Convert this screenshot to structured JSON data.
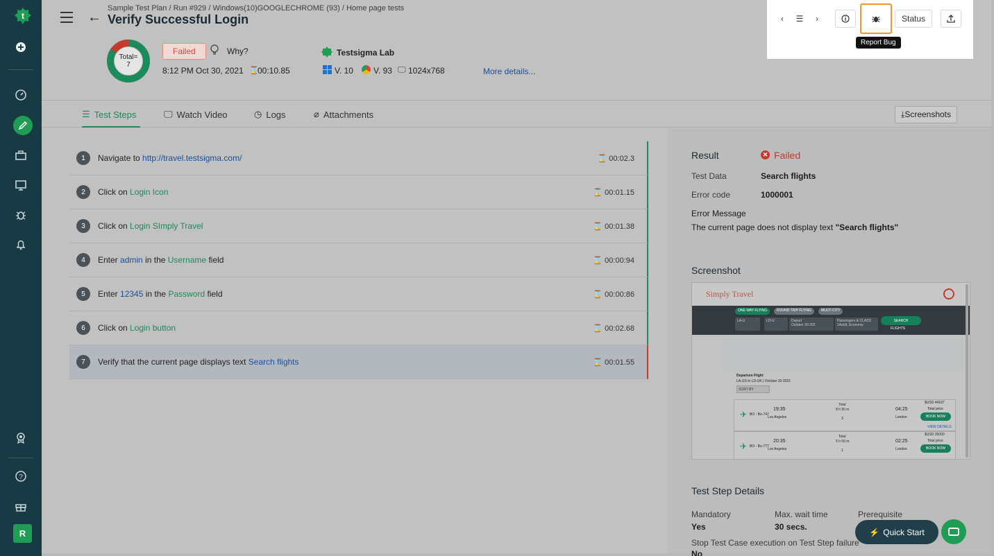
{
  "sidebar": {
    "avatar_initial": "R",
    "icons": [
      "logo-icon",
      "add-icon",
      "dashboard-icon",
      "edit-icon",
      "briefcase-icon",
      "monitor-icon",
      "bug-icon",
      "bell-icon",
      "award-icon",
      "help-icon",
      "gift-icon"
    ]
  },
  "header": {
    "breadcrumb": "Sample Test Plan / Run #929 / Windows(10)GOOGLECHROME (93) / Home page tests",
    "title": "Verify Successful Login",
    "donut_total_label": "Total=",
    "donut_total_value": "7",
    "status": "Failed",
    "why_label": "Why?",
    "run_time": "8:12 PM Oct 30, 2021",
    "duration": "00:10.85",
    "lab_name": "Testsigma Lab",
    "os_version": "V. 10",
    "browser_version": "V. 93",
    "resolution": "1024x768",
    "more_details": "More details..."
  },
  "toolbar": {
    "status_label": "Status",
    "tooltip": "Report Bug"
  },
  "tabs": [
    {
      "label": "Test Steps",
      "active": true
    },
    {
      "label": "Watch Video",
      "active": false
    },
    {
      "label": "Logs",
      "active": false
    },
    {
      "label": "Attachments",
      "active": false
    }
  ],
  "screenshots_button": "Screenshots",
  "steps": [
    {
      "num": "1",
      "pre": "Navigate to",
      "a": "http://travel.testsigma.com/",
      "mid": "",
      "b": "",
      "post": "",
      "time": "00:02.3",
      "state": "passed"
    },
    {
      "num": "2",
      "pre": "Click on",
      "a": "Login Icon",
      "mid": "",
      "b": "",
      "post": "",
      "time": "00:01.15",
      "state": "passed"
    },
    {
      "num": "3",
      "pre": "Click on",
      "a": "Login SImply Travel",
      "mid": "",
      "b": "",
      "post": "",
      "time": "00:01.38",
      "state": "passed"
    },
    {
      "num": "4",
      "pre": "Enter",
      "a": "admin",
      "mid": "in the",
      "b": "Username",
      "post": "field",
      "time": "00:00:94",
      "state": "passed"
    },
    {
      "num": "5",
      "pre": "Enter",
      "a": "12345",
      "mid": "in the",
      "b": "Password",
      "post": "field",
      "time": "00:00:86",
      "state": "passed"
    },
    {
      "num": "6",
      "pre": "Click on",
      "a": "Login button",
      "mid": "",
      "b": "",
      "post": "",
      "time": "00:02.68",
      "state": "passed"
    },
    {
      "num": "7",
      "pre": "Verify that the current page displays text",
      "a": "Search flights",
      "mid": "",
      "b": "",
      "post": "",
      "time": "00:01.55",
      "state": "failed"
    }
  ],
  "result": {
    "heading": "Result",
    "status": "Failed",
    "test_data_label": "Test Data",
    "test_data_value": "Search flights",
    "error_code_label": "Error code",
    "error_code_value": "1000001",
    "error_message_label": "Error Message",
    "error_message_text": "The current page does not display text",
    "error_message_quote": "\"Search flights\""
  },
  "screenshot": {
    "heading": "Screenshot",
    "app_logo": "Simply Travel",
    "trip_types": [
      "ONE WAY FLYING",
      "ROUND TRIP FLYING",
      "MULTI CITY"
    ],
    "from": "LA-U",
    "to": "LD-U",
    "depart_label": "Depart",
    "depart_value": "October 30 202",
    "passengers_label": "Passengers & CLASS",
    "passengers_value": "1Adult, Economy",
    "search_button": "SEARCH",
    "flights_label": "FLIGHTS",
    "departure_flight": "Departure Flight",
    "route": "LA-US to LD-UK | October 30 2021",
    "sort_by": "SORT BY",
    "flights": [
      {
        "code": "BO - Bo-747",
        "dep": "19:35",
        "from": "Los Angeles",
        "total": "Total",
        "duration": "8 h 50 m",
        "stops": "3",
        "arr": "04:25",
        "to": "London",
        "price": "$USD 44167",
        "price_label": "Total price",
        "book": "BOOK NOW",
        "details": "VIEW DETAILS"
      },
      {
        "code": "BO - Bo-777",
        "dep": "20:35",
        "from": "Los Angeles",
        "total": "Total",
        "duration": "5 h 50 m",
        "stops": "1",
        "arr": "02:25",
        "to": "London",
        "price": "$USD 35000",
        "price_label": "Total price",
        "book": "BOOK NOW",
        "details": ""
      }
    ]
  },
  "details": {
    "heading": "Test Step Details",
    "mandatory_label": "Mandatory",
    "mandatory_value": "Yes",
    "wait_label": "Max. wait time",
    "wait_value": "30 secs.",
    "prereq_label": "Prerequisite",
    "stop_label": "Stop Test Case execution on Test Step failure",
    "stop_value": "No"
  },
  "quick_start": "Quick Start",
  "colors": {
    "accent": "#1c8a5a",
    "failed": "#c43a2d",
    "sidebar": "#173a45",
    "highlight": "#f0962d"
  }
}
